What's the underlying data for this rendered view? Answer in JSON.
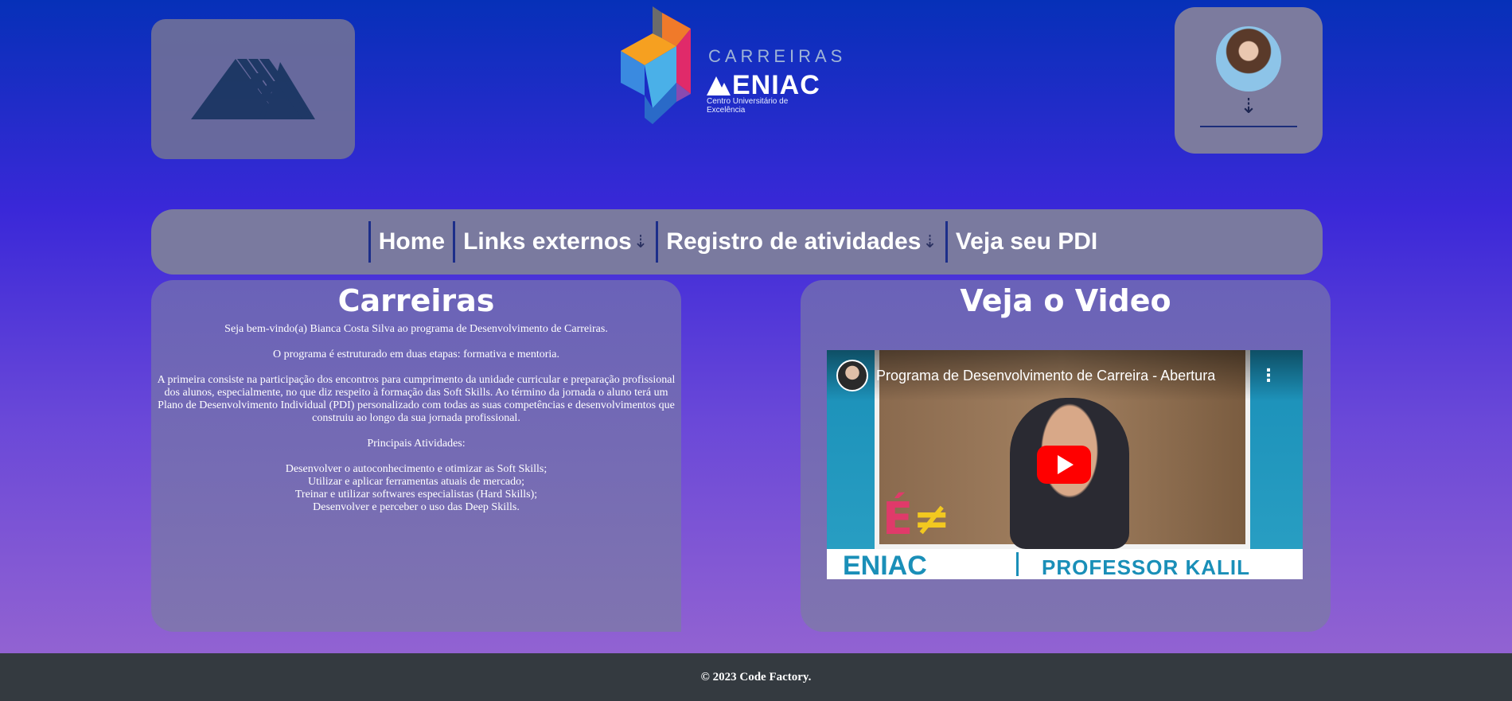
{
  "header": {
    "brand_top": "CARREIRAS",
    "brand_main": "ENIAC",
    "brand_sub": "Centro Universitário de Excelência",
    "user_menu_arrow": "⇣"
  },
  "nav": {
    "items": [
      {
        "label": "Home",
        "has_dropdown": false
      },
      {
        "label": "Links externos",
        "has_dropdown": true
      },
      {
        "label": "Registro de atividades",
        "has_dropdown": true
      },
      {
        "label": "Veja seu PDI",
        "has_dropdown": false
      }
    ],
    "dropdown_arrow": "⇣"
  },
  "carreiras": {
    "title": "Carreiras",
    "welcome": "Seja bem-vindo(a) Bianca Costa Silva ao programa de Desenvolvimento de Carreiras.",
    "structure": "O programa é estruturado em duas etapas: formativa e mentoria.",
    "first_stage": "A primeira consiste na participação dos encontros para cumprimento da unidade curricular e preparação profissional dos alunos, especialmente, no que diz respeito à formação das Soft Skills. Ao término da jornada o aluno terá um Plano de Desenvolvimento Individual (PDI) personalizado com todas as suas competências e desenvolvimentos que construiu ao longo da sua jornada profissional.",
    "activities_title": "Principais Atividades:",
    "activities": [
      "Desenvolver o autoconhecimento e otimizar as Soft Skills;",
      "Utilizar e aplicar ferramentas atuais de mercado;",
      "Treinar e utilizar softwares especialistas (Hard Skills);",
      "Desenvolver e perceber o uso das Deep Skills."
    ]
  },
  "video": {
    "section_title": "Veja o Video",
    "title": "Programa de Desenvolvimento de Carreira - Abertura",
    "banner_logo": "ENIAC",
    "banner_name": "PROFESSOR KALIL",
    "kebab": "⋮"
  },
  "footer": {
    "text": "© 2023 Code Factory."
  },
  "colors": {
    "accent": "#1c2e8a",
    "footer_bg": "#343a40",
    "play_red": "#ff0000"
  }
}
